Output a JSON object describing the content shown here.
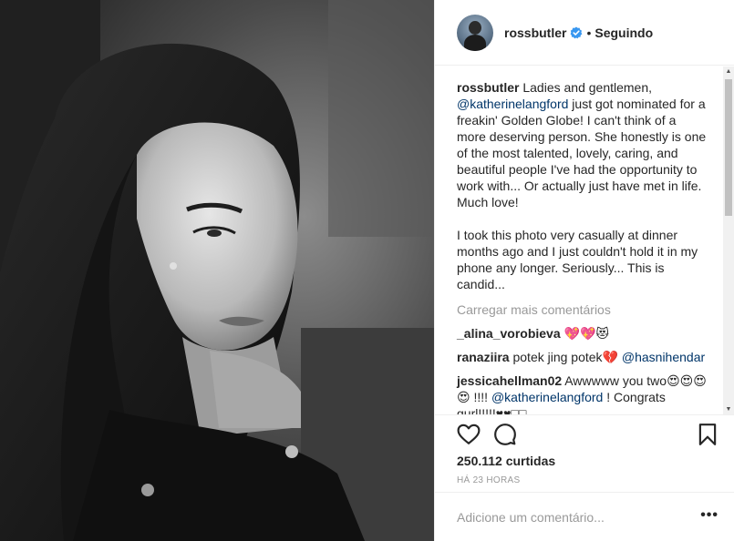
{
  "post": {
    "username": "rossbutler",
    "follow_separator": "•",
    "follow_status": "Seguindo",
    "likes": "250.112 curtidas",
    "time_ago": "HÁ 23 HORAS"
  },
  "caption": {
    "username": "rossbutler",
    "text_intro": " Ladies and gentlemen, ",
    "mention": "@katherinelangford",
    "text_rest": " just got nominated for a freakin' Golden Globe! I can't think of a more deserving person. She honestly is one of the most talented, lovely, caring, and beautiful people I've had the opportunity to work with... Or actually just have met in life. Much love!\n\nI took this photo very casually at dinner months ago and I just couldn't hold it in my phone any longer. Seriously... This is candid..."
  },
  "load_more": "Carregar mais comentários",
  "comments": [
    {
      "username": "_alina_vorobieva",
      "text": " 💖💖😻",
      "mention": "",
      "text_after": ""
    },
    {
      "username": "ranaziira",
      "text": " potek jing potek💔 ",
      "mention": "@hasnihendar",
      "text_after": ""
    },
    {
      "username": "jessicahellman02",
      "text": " Awwwww you two😍😍😍😍 !!!! ",
      "mention": "@katherinelangford",
      "text_after": " ! Congrats gurl!!!!!♥♥□□"
    }
  ],
  "add_comment": {
    "placeholder": "Adicione um comentário...",
    "more_label": "•••"
  },
  "icons": {
    "like": "heart-icon",
    "comment": "comment-icon",
    "save": "bookmark-icon",
    "verified": "verified-badge-icon"
  },
  "colors": {
    "verified": "#3897f0",
    "mention": "#003569",
    "muted": "#999999",
    "text": "#262626",
    "border": "#efefef"
  }
}
